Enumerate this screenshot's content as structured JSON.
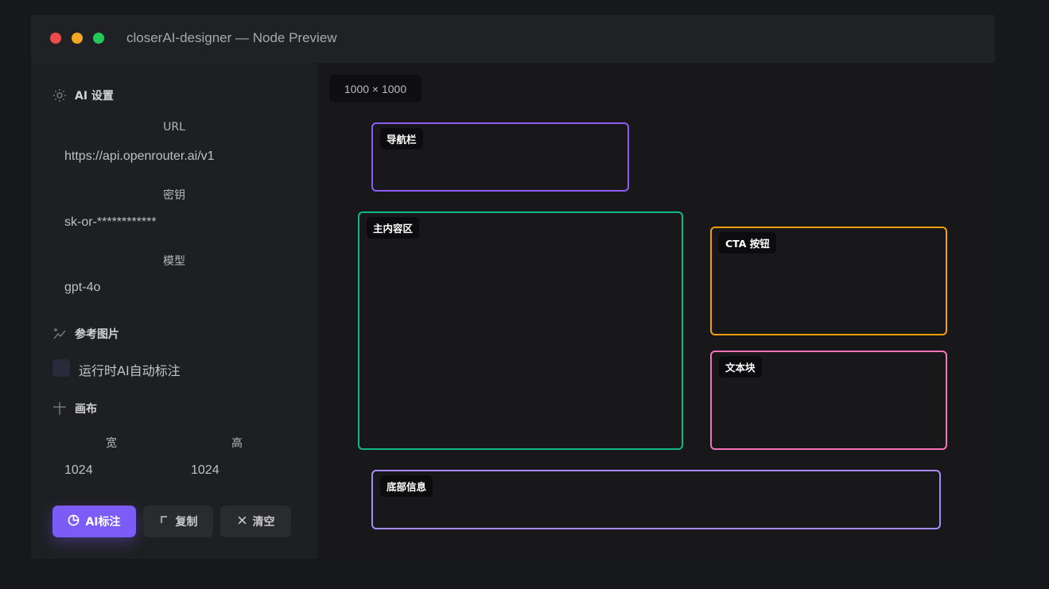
{
  "window": {
    "title": "closerAI-designer — Node Preview"
  },
  "sidebar": {
    "ai_settings": {
      "heading": "AI 设置",
      "icon": "sun-icon",
      "url_label": "URL",
      "url_value": "https://api.openrouter.ai/v1",
      "key_label": "密钥",
      "key_value": "sk-or-************",
      "model_label": "模型",
      "model_value": "gpt-4o"
    },
    "reference": {
      "heading": "参考图片",
      "icon": "image-icon",
      "auto_label": "运行时AI自动标注",
      "auto_checked": false
    },
    "canvas": {
      "heading": "画布",
      "icon": "crosshair-icon",
      "width_label": "宽",
      "width_value": "1024",
      "height_label": "高",
      "height_value": "1024"
    },
    "buttons": {
      "annotate": "AI标注",
      "copy": "复制",
      "clear": "清空"
    }
  },
  "preview": {
    "size_badge": "1000 × 1000",
    "regions": {
      "nav": {
        "label": "导航栏",
        "color": "#8b5cf6"
      },
      "main": {
        "label": "主内容区",
        "color": "#10b981"
      },
      "cta": {
        "label": "CTA 按钮",
        "color": "#f59e0b"
      },
      "text": {
        "label": "文本块",
        "color": "#f472b6"
      },
      "footer": {
        "label": "底部信息",
        "color": "#a78bfa"
      }
    }
  }
}
